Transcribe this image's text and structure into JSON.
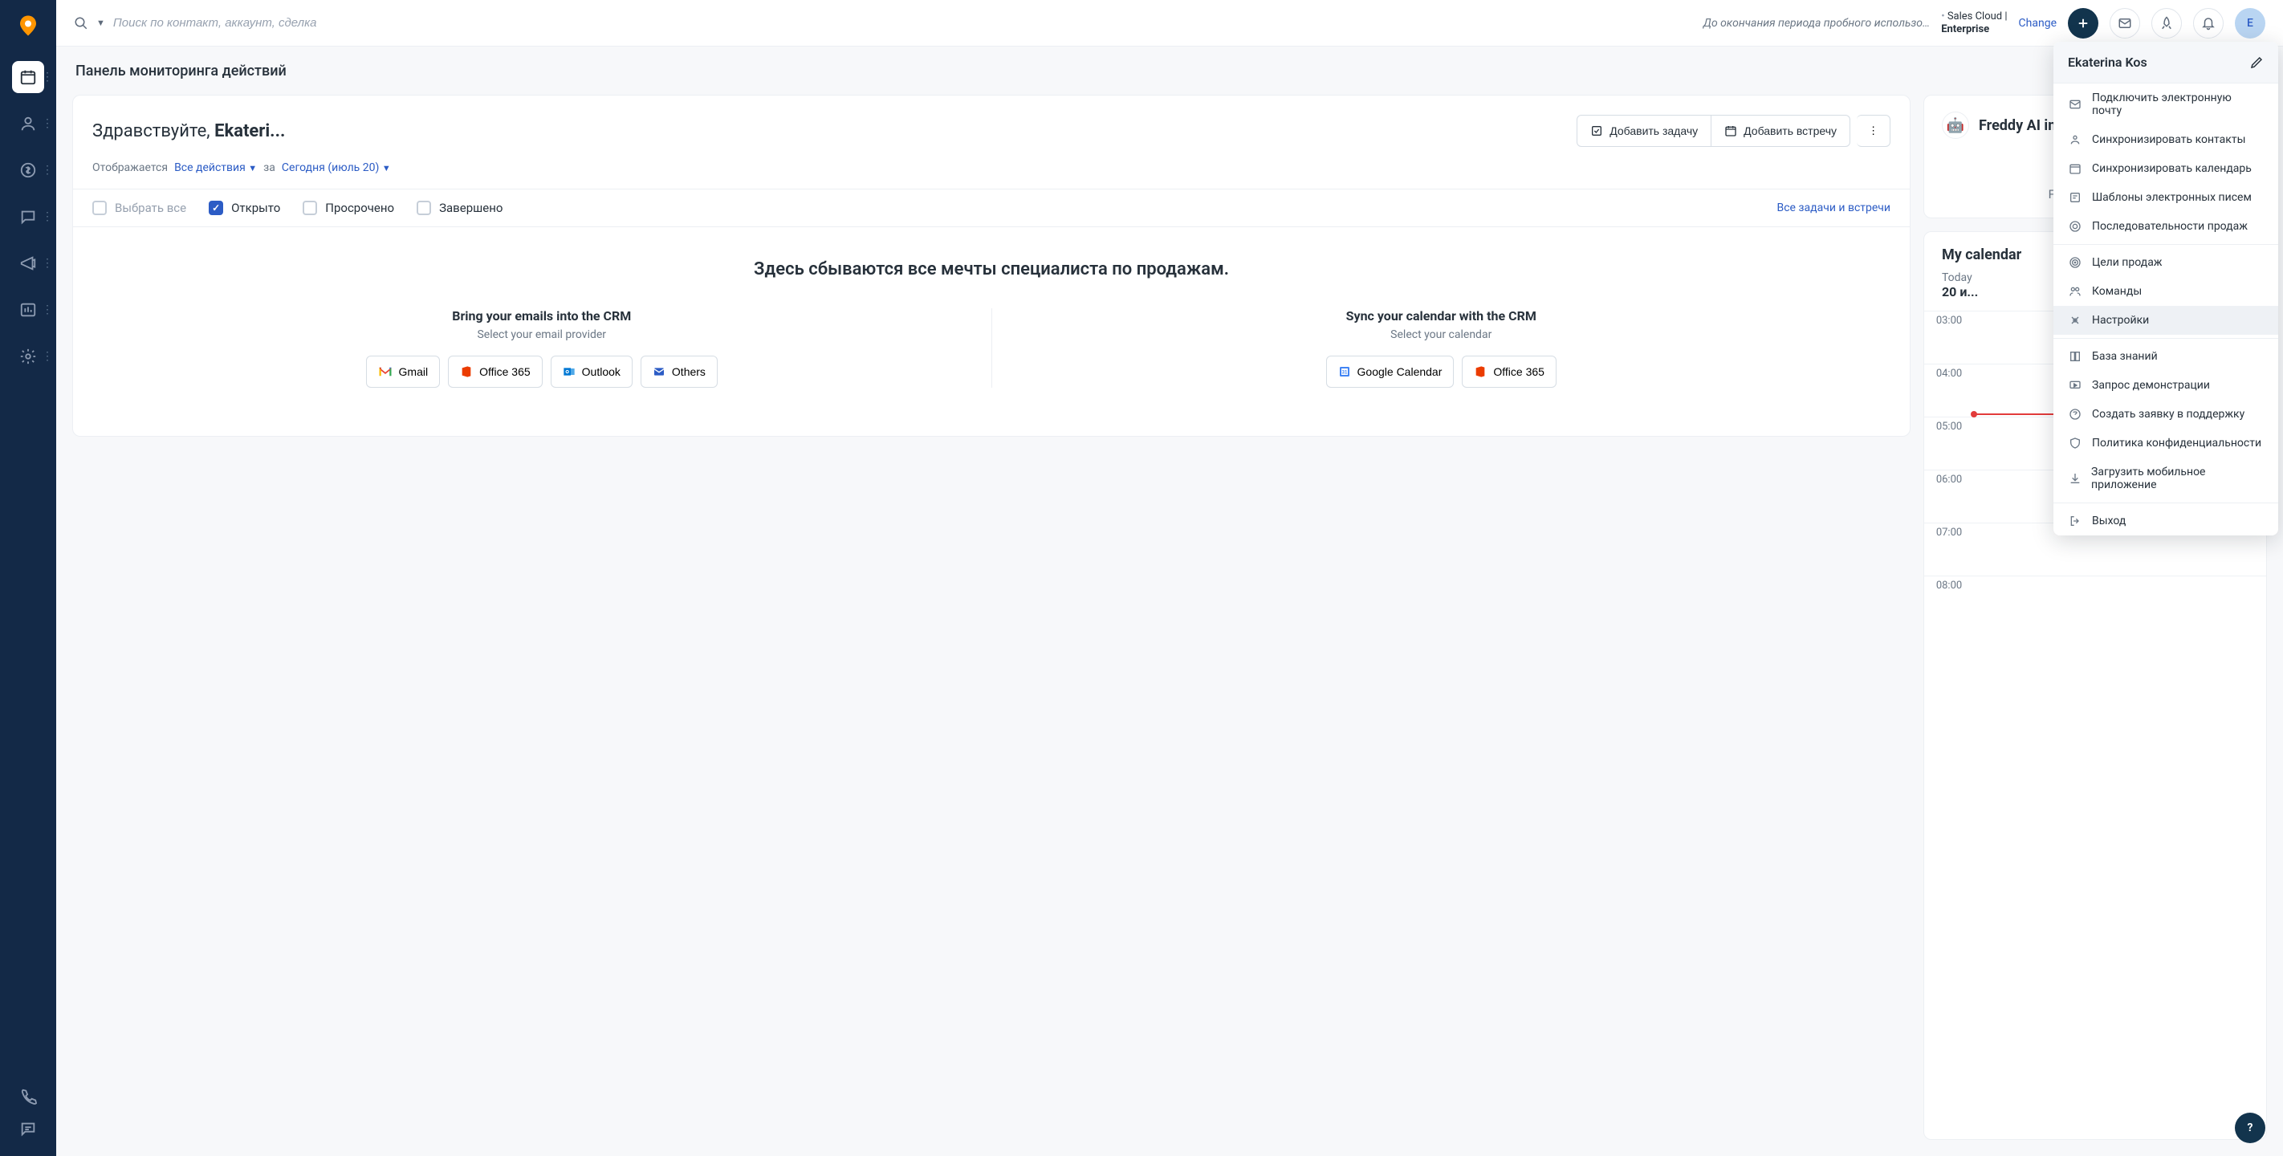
{
  "topbar": {
    "search_placeholder": "Поиск по контакт, аккаунт, сделка",
    "trial_text": "До окончания периода пробного использо…",
    "plan_line1": "Sales Cloud |",
    "plan_line2": "Enterprise",
    "change": "Change",
    "avatar_initial": "E"
  },
  "page_title": "Панель мониторинга действий",
  "greeting_prefix": "Здравствуйте, ",
  "greeting_name": "Ekateri...",
  "actions": {
    "add_task": "Добавить задачу",
    "add_meeting": "Добавить встречу"
  },
  "filters": {
    "showing": "Отображается",
    "all_actions": "Все действия",
    "for": "за",
    "today": "Сегодня (июль 20)"
  },
  "statuses": {
    "select_all": "Выбрать все",
    "open": "Открыто",
    "overdue": "Просрочено",
    "done": "Завершено",
    "all_tasks_link": "Все задачи и встречи"
  },
  "empty": {
    "title": "Здесь сбываются все мечты специалиста по продажам.",
    "emails_title": "Bring your emails into the CRM",
    "emails_sub": "Select your email provider",
    "calendar_title": "Sync your calendar with the CRM",
    "calendar_sub": "Select your calendar",
    "gmail": "Gmail",
    "office365": "Office 365",
    "outlook": "Outlook",
    "others": "Others",
    "gcal": "Google Calendar"
  },
  "freddy": {
    "title": "Freddy AI ins",
    "body": "Freddy doesn't ha"
  },
  "calendar": {
    "title": "My calendar",
    "today_label": "Today",
    "today_date": "20 и...",
    "hours": [
      "03:00",
      "04:00",
      "05:00",
      "06:00",
      "07:00",
      "08:00"
    ]
  },
  "user_menu": {
    "name": "Ekaterina Kos",
    "items": [
      {
        "icon": "mail",
        "label": "Подключить электронную почту"
      },
      {
        "icon": "contacts",
        "label": "Синхронизировать контакты"
      },
      {
        "icon": "cal",
        "label": "Синхронизировать календарь"
      },
      {
        "icon": "template",
        "label": "Шаблоны электронных писем"
      },
      {
        "icon": "sequence",
        "label": "Последовательности продаж"
      }
    ],
    "items2": [
      {
        "icon": "target",
        "label": "Цели продаж"
      },
      {
        "icon": "team",
        "label": "Команды"
      },
      {
        "icon": "settings",
        "label": "Настройки",
        "hovered": true
      }
    ],
    "items3": [
      {
        "icon": "book",
        "label": "База знаний"
      },
      {
        "icon": "demo",
        "label": "Запрос демонстрации"
      },
      {
        "icon": "support",
        "label": "Создать заявку в поддержку"
      },
      {
        "icon": "shield",
        "label": "Политика конфиденциальности"
      },
      {
        "icon": "download",
        "label": "Загрузить мобильное приложение"
      }
    ],
    "items4": [
      {
        "icon": "logout",
        "label": "Выход"
      }
    ]
  }
}
